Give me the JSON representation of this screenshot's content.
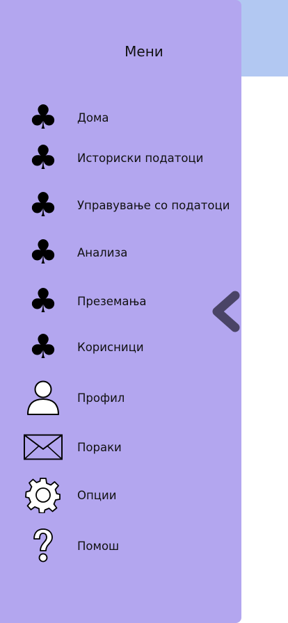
{
  "menu": {
    "title": "Мени",
    "items": [
      {
        "label": "Дома",
        "icon": "club-icon"
      },
      {
        "label": "Историски податоци",
        "icon": "club-icon"
      },
      {
        "label": "Управување со податоци",
        "icon": "club-icon"
      },
      {
        "label": "Анализа",
        "icon": "club-icon"
      },
      {
        "label": "Преземања",
        "icon": "club-icon"
      },
      {
        "label": "Корисници",
        "icon": "club-icon"
      },
      {
        "label": "Профил",
        "icon": "user-icon"
      },
      {
        "label": "Пораки",
        "icon": "envelope-icon"
      },
      {
        "label": "Опции",
        "icon": "gear-icon"
      },
      {
        "label": "Помош",
        "icon": "question-icon"
      }
    ],
    "club_glyph": "♣",
    "collapse_icon": "chevron-left-icon"
  },
  "colors": {
    "drawer": "#b3a6ef",
    "top_band": "#b2c8f2",
    "chevron": "#4a4466"
  }
}
